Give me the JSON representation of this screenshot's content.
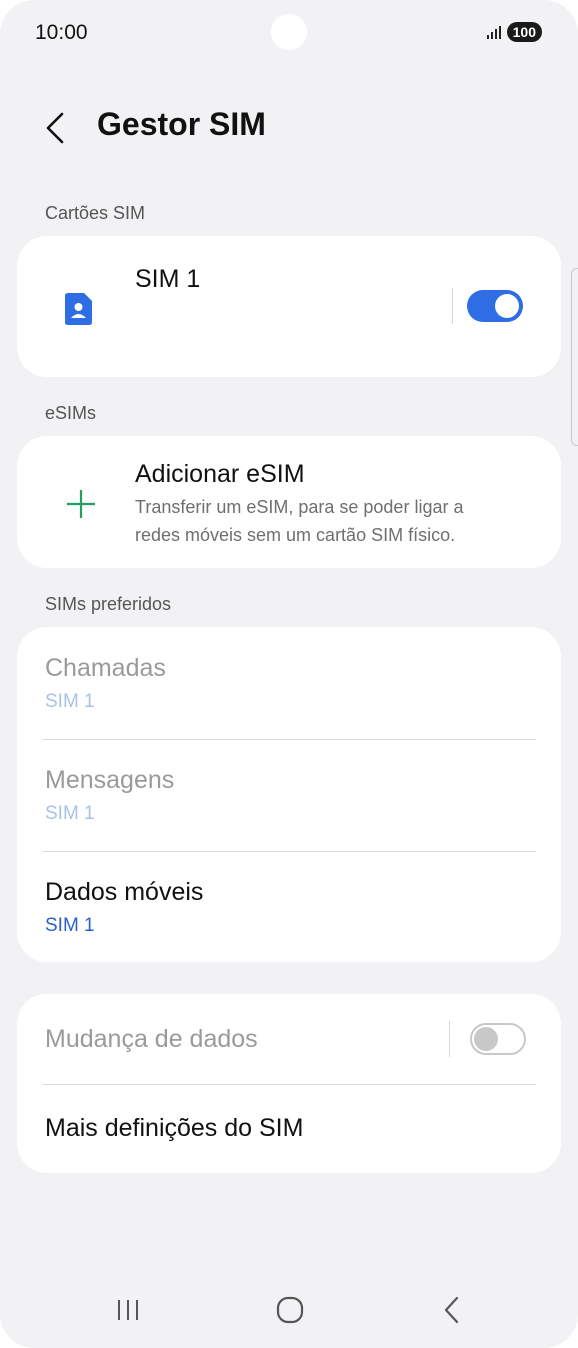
{
  "status_bar": {
    "time": "10:00",
    "battery": "100"
  },
  "header": {
    "title": "Gestor SIM"
  },
  "sections": {
    "sim_cards": "Cartões SIM",
    "esims": "eSIMs",
    "preferred": "SIMs preferidos"
  },
  "sim1": {
    "label": "SIM 1",
    "enabled": true
  },
  "add_esim": {
    "title": "Adicionar eSIM",
    "description_line1": "Transferir um eSIM, para se poder ligar a",
    "description_line2": "redes móveis sem um cartão SIM físico."
  },
  "preferred": {
    "calls": {
      "title": "Chamadas",
      "value": "SIM 1"
    },
    "messages": {
      "title": "Mensagens",
      "value": "SIM 1"
    },
    "mobile_data": {
      "title": "Dados móveis",
      "value": "SIM 1"
    }
  },
  "data_switch": {
    "title": "Mudança de dados",
    "enabled": false
  },
  "more_settings": {
    "title": "Mais definições do SIM"
  },
  "colors": {
    "accent": "#2e6de3",
    "background": "#f2f2f4",
    "card": "#ffffff",
    "plus_icon": "#22a05a"
  },
  "icons": [
    "back-arrow-icon",
    "sim-card-icon",
    "plus-icon",
    "recent-apps-icon",
    "home-icon",
    "back-nav-icon"
  ]
}
